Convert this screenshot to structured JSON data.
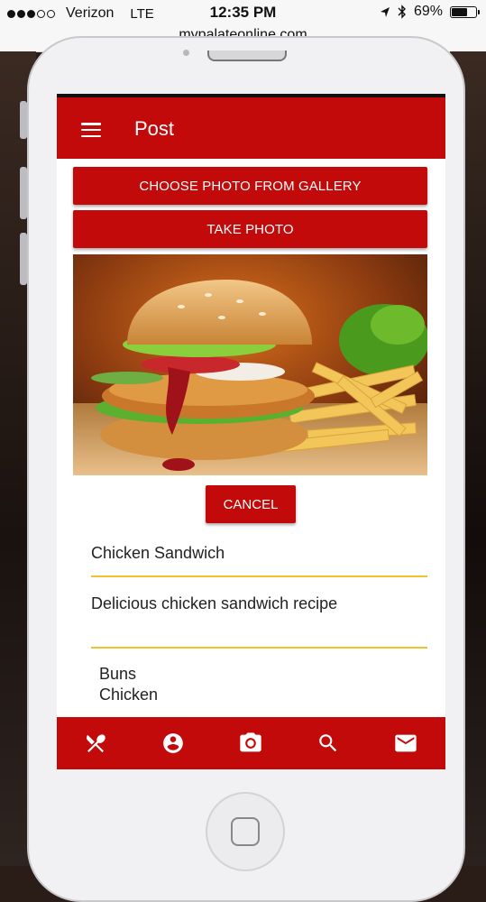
{
  "ios": {
    "carrier": "Verizon",
    "network": "LTE",
    "time": "12:35 PM",
    "battery_percent": "69%",
    "battery_level": 0.69,
    "url": "mypalateonline.com"
  },
  "app": {
    "title": "Post",
    "choose_photo_label": "CHOOSE PHOTO FROM GALLERY",
    "take_photo_label": "TAKE PHOTO",
    "cancel_label": "CANCEL",
    "recipe_name": "Chicken Sandwich",
    "recipe_description": "Delicious chicken sandwich recipe",
    "ingredients": [
      "Buns",
      "Chicken"
    ],
    "accent_color": "#c20a0a",
    "underline_color": "#f2c12e"
  },
  "bottom_nav": [
    {
      "icon": "utensils-icon"
    },
    {
      "icon": "account-icon"
    },
    {
      "icon": "camera-icon",
      "active": true
    },
    {
      "icon": "search-icon"
    },
    {
      "icon": "mail-icon"
    }
  ]
}
